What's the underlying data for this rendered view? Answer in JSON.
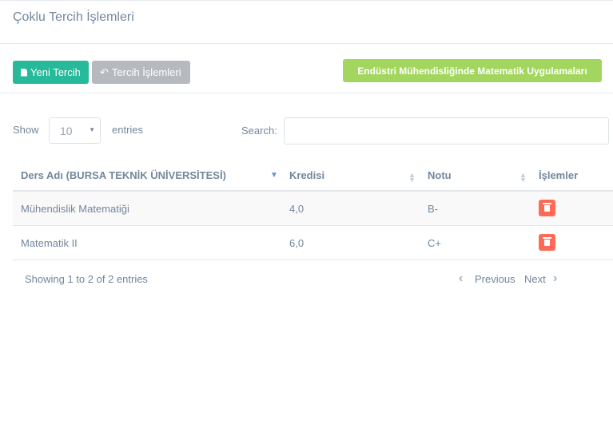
{
  "header": {
    "title": "Çoklu Tercih İşlemleri"
  },
  "toolbar": {
    "new_label": "Yeni Tercih",
    "ops_label": "Tercih İşlemleri",
    "course_label": "Endüstri Mühendisliğinde Matematik Uygulamaları"
  },
  "table_controls": {
    "show_label": "Show",
    "page_size": "10",
    "entries_label": "entries",
    "search_label": "Search:",
    "search_value": ""
  },
  "table": {
    "columns": [
      "Ders Adı (BURSA TEKNİK ÜNİVERSİTESİ)",
      "Kredisi",
      "Notu",
      "İşlemler"
    ],
    "rows": [
      [
        "Mühendislik Matematiği",
        "4,0",
        "B-"
      ],
      [
        "Matematik II",
        "6,0",
        "C+"
      ]
    ]
  },
  "footer": {
    "info": "Showing 1 to 2 of 2 entries",
    "previous": "Previous",
    "next": "Next"
  },
  "colors": {
    "accent": "#26b99a",
    "danger": "#ff6a57",
    "course": "#a3d65e"
  }
}
